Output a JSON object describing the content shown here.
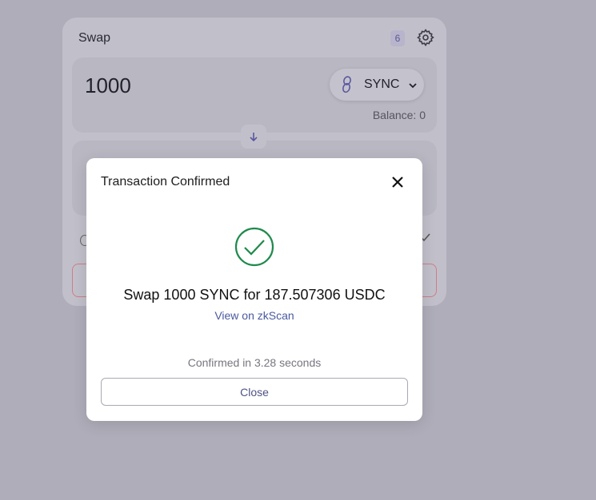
{
  "swap": {
    "title": "Swap",
    "nonce_badge": "6",
    "input_amount": "1000",
    "from_token": "SYNC",
    "balance": "Balance: 0"
  },
  "modal": {
    "title": "Transaction Confirmed",
    "summary": "Swap 1000 SYNC for 187.507306 USDC",
    "link_label": "View on zkScan",
    "confirm_time": "Confirmed in 3.28 seconds",
    "close_label": "Close"
  },
  "colors": {
    "success": "#1f8a4c",
    "link": "#4a5a9e",
    "overlay": "#aeadb9"
  },
  "icons": [
    "settings-icon",
    "sync-token-icon",
    "chevron-down-icon",
    "arrow-down-icon",
    "close-icon",
    "check-circle-icon"
  ]
}
